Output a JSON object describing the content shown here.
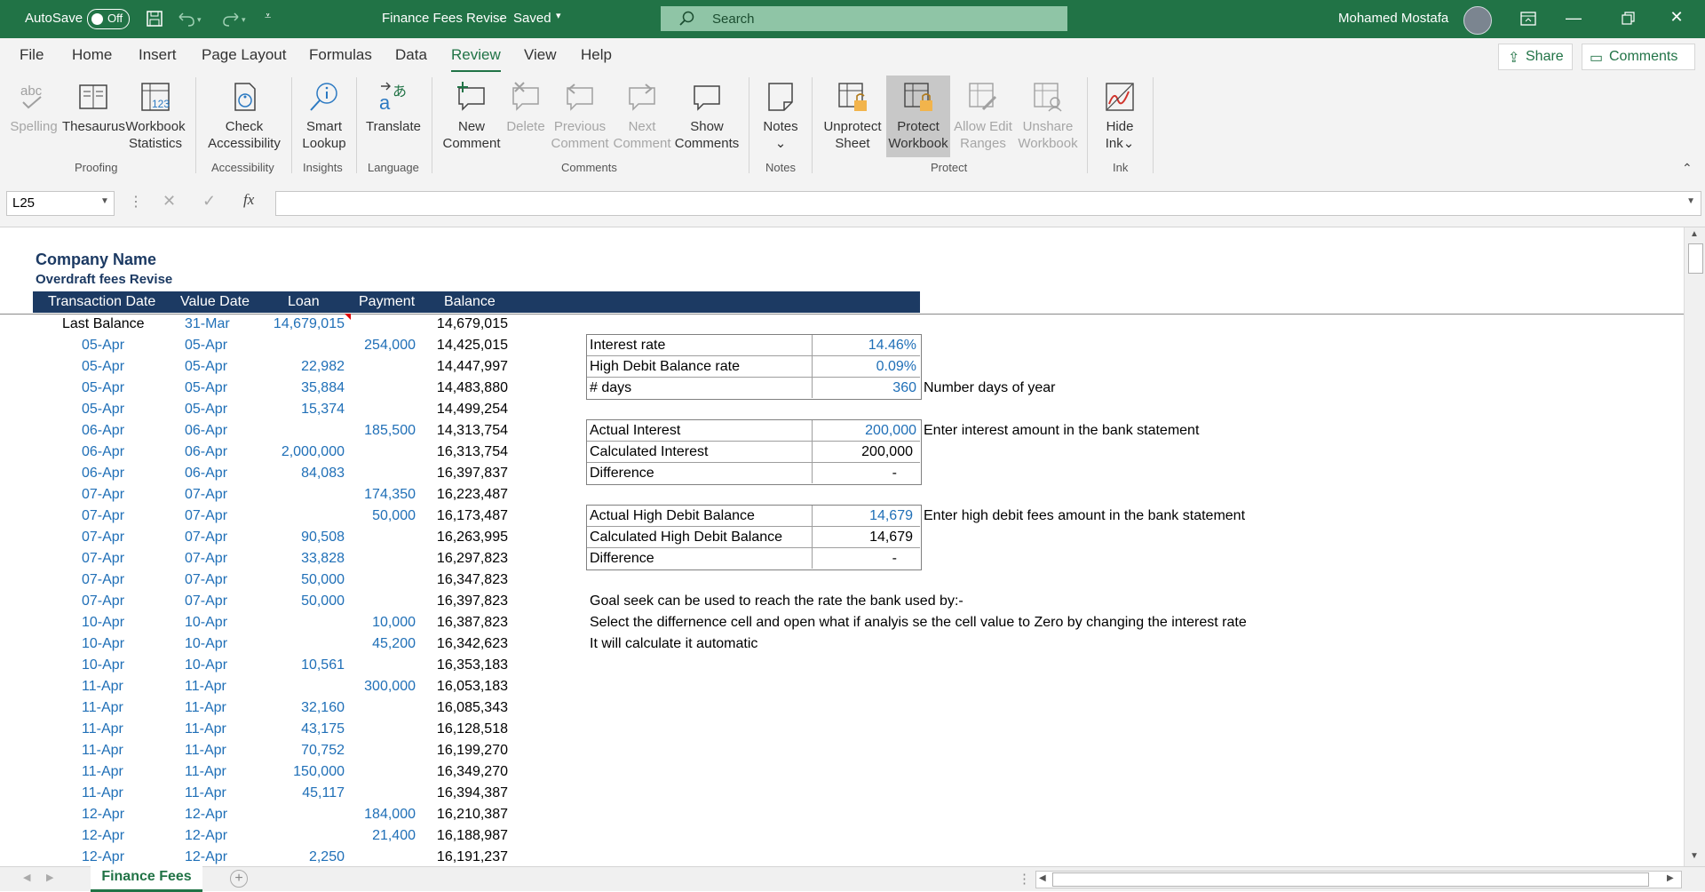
{
  "titlebar": {
    "autosave_label": "AutoSave",
    "autosave_state": "Off",
    "doc_title": "Finance Fees Revise",
    "save_status": "Saved",
    "search_placeholder": "Search",
    "user_name": "Mohamed Mostafa"
  },
  "tabs": [
    "File",
    "Home",
    "Insert",
    "Page Layout",
    "Formulas",
    "Data",
    "Review",
    "View",
    "Help"
  ],
  "share_label": "Share",
  "comments_label": "Comments",
  "ribbon": {
    "spelling": "Spelling",
    "thesaurus": "Thesaurus",
    "workbook_stats_1": "Workbook",
    "workbook_stats_2": "Statistics",
    "check_acc_1": "Check",
    "check_acc_2": "Accessibility",
    "smart_1": "Smart",
    "smart_2": "Lookup",
    "translate": "Translate",
    "new_c_1": "New",
    "new_c_2": "Comment",
    "delete": "Delete",
    "prev_1": "Previous",
    "prev_2": "Comment",
    "next_1": "Next",
    "next_2": "Comment",
    "show_1": "Show",
    "show_2": "Comments",
    "notes": "Notes",
    "unprot_1": "Unprotect",
    "unprot_2": "Sheet",
    "protwb_1": "Protect",
    "protwb_2": "Workbook",
    "allow_1": "Allow Edit",
    "allow_2": "Ranges",
    "unshare_1": "Unshare",
    "unshare_2": "Workbook",
    "hide_1": "Hide",
    "hide_2": "Ink",
    "groups": {
      "proofing": "Proofing",
      "accessibility": "Accessibility",
      "insights": "Insights",
      "language": "Language",
      "comments": "Comments",
      "notes": "Notes",
      "protect": "Protect",
      "ink": "Ink"
    }
  },
  "namebox": "L25",
  "fx_symbol": "fx",
  "sheet": {
    "company": "Company Name",
    "subtitle": "Overdraft fees Revise",
    "headers": [
      "Transaction Date",
      "Value Date",
      "Loan",
      "Payment",
      "Balance"
    ],
    "rows": [
      [
        "Last Balance",
        "31-Mar",
        "14,679,015",
        "",
        "14,679,015"
      ],
      [
        "05-Apr",
        "05-Apr",
        "",
        "254,000",
        "14,425,015"
      ],
      [
        "05-Apr",
        "05-Apr",
        "22,982",
        "",
        "14,447,997"
      ],
      [
        "05-Apr",
        "05-Apr",
        "35,884",
        "",
        "14,483,880"
      ],
      [
        "05-Apr",
        "05-Apr",
        "15,374",
        "",
        "14,499,254"
      ],
      [
        "06-Apr",
        "06-Apr",
        "",
        "185,500",
        "14,313,754"
      ],
      [
        "06-Apr",
        "06-Apr",
        "2,000,000",
        "",
        "16,313,754"
      ],
      [
        "06-Apr",
        "06-Apr",
        "84,083",
        "",
        "16,397,837"
      ],
      [
        "07-Apr",
        "07-Apr",
        "",
        "174,350",
        "16,223,487"
      ],
      [
        "07-Apr",
        "07-Apr",
        "",
        "50,000",
        "16,173,487"
      ],
      [
        "07-Apr",
        "07-Apr",
        "90,508",
        "",
        "16,263,995"
      ],
      [
        "07-Apr",
        "07-Apr",
        "33,828",
        "",
        "16,297,823"
      ],
      [
        "07-Apr",
        "07-Apr",
        "50,000",
        "",
        "16,347,823"
      ],
      [
        "07-Apr",
        "07-Apr",
        "50,000",
        "",
        "16,397,823"
      ],
      [
        "10-Apr",
        "10-Apr",
        "",
        "10,000",
        "16,387,823"
      ],
      [
        "10-Apr",
        "10-Apr",
        "",
        "45,200",
        "16,342,623"
      ],
      [
        "10-Apr",
        "10-Apr",
        "10,561",
        "",
        "16,353,183"
      ],
      [
        "11-Apr",
        "11-Apr",
        "",
        "300,000",
        "16,053,183"
      ],
      [
        "11-Apr",
        "11-Apr",
        "32,160",
        "",
        "16,085,343"
      ],
      [
        "11-Apr",
        "11-Apr",
        "43,175",
        "",
        "16,128,518"
      ],
      [
        "11-Apr",
        "11-Apr",
        "70,752",
        "",
        "16,199,270"
      ],
      [
        "11-Apr",
        "11-Apr",
        "150,000",
        "",
        "16,349,270"
      ],
      [
        "11-Apr",
        "11-Apr",
        "45,117",
        "",
        "16,394,387"
      ],
      [
        "12-Apr",
        "12-Apr",
        "",
        "184,000",
        "16,210,387"
      ],
      [
        "12-Apr",
        "12-Apr",
        "",
        "21,400",
        "16,188,987"
      ],
      [
        "12-Apr",
        "12-Apr",
        "2,250",
        "",
        "16,191,237"
      ]
    ],
    "calc": {
      "interest_rate_label": "Interest rate",
      "interest_rate": "14.46%",
      "hdb_rate_label": "High Debit Balance rate",
      "hdb_rate": "0.09%",
      "days_label": "# days",
      "days": "360",
      "days_note": "Number days of year",
      "actual_interest_label": "Actual Interest",
      "actual_interest": "200,000",
      "actual_interest_note": "Enter interest amount in the bank statement",
      "calc_interest_label": "Calculated Interest",
      "calc_interest": "200,000",
      "diff_label": "Difference",
      "diff1": "-",
      "actual_hdb_label": "Actual High Debit Balance",
      "actual_hdb": "14,679",
      "actual_hdb_note": "Enter high debit fees amount in the bank statement",
      "calc_hdb_label": "Calculated High Debit Balance",
      "calc_hdb": "14,679",
      "diff2": "-",
      "note1": "Goal seek can be used to reach the rate the bank used by:-",
      "note2": "Select the differnence cell and open what if analyis se the cell value to Zero by changing the interest rate",
      "note3": " It will calculate it automatic"
    }
  },
  "sheet_tab": "Finance Fees"
}
